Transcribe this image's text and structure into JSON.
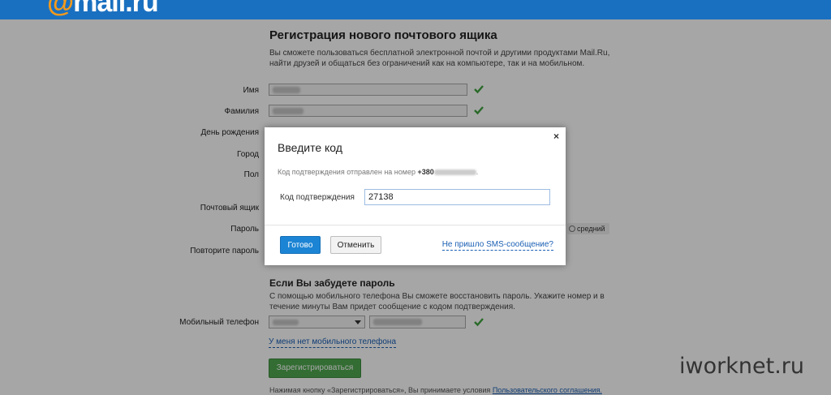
{
  "header": {
    "logo_at": "@",
    "logo_text": "mail.ru"
  },
  "form": {
    "title": "Регистрация нового почтового ящика",
    "intro": "Вы сможете пользоваться бесплатной электронной почтой и другими продуктами Mail.Ru, найти друзей и общаться без ограничений как на компьютере, так и на мобильном.",
    "labels": {
      "first_name": "Имя",
      "last_name": "Фамилия",
      "birthday": "День рождения",
      "city": "Город",
      "gender": "Пол",
      "mailbox": "Почтовый ящик",
      "password": "Пароль",
      "repeat_password": "Повторите пароль",
      "mobile": "Мобильный телефон"
    },
    "password_strength": "средний",
    "forgot_title": "Если Вы забудете пароль",
    "forgot_text": "С помощью мобильного телефона Вы сможете восстановить пароль. Укажите номер и в течение минуты Вам придет сообщение с кодом подтверждения.",
    "no_phone_link": "У меня нет мобильного телефона",
    "register_button": "Зарегистрироваться",
    "terms_text": "Нажимая кнопку «Зарегистрироваться», Вы принимаете условия",
    "terms_link": "Пользовательского соглашения."
  },
  "modal": {
    "close_glyph": "×",
    "title": "Введите код",
    "info_text": "Код подтверждения отправлен на номер",
    "phone_prefix": "+380",
    "code_label": "Код подтверждения",
    "code_value": "27138",
    "ok_button": "Готово",
    "cancel_button": "Отменить",
    "sms_link": "Не пришло SMS-сообщение?"
  },
  "watermark": "iworknet.ru",
  "colors": {
    "topbar": "#1a70c0",
    "logo_at": "#f39a1c",
    "check": "#3fa33f",
    "register": "#4fa84f",
    "ok_button": "#1c84d4",
    "link": "#1a5fb4"
  }
}
